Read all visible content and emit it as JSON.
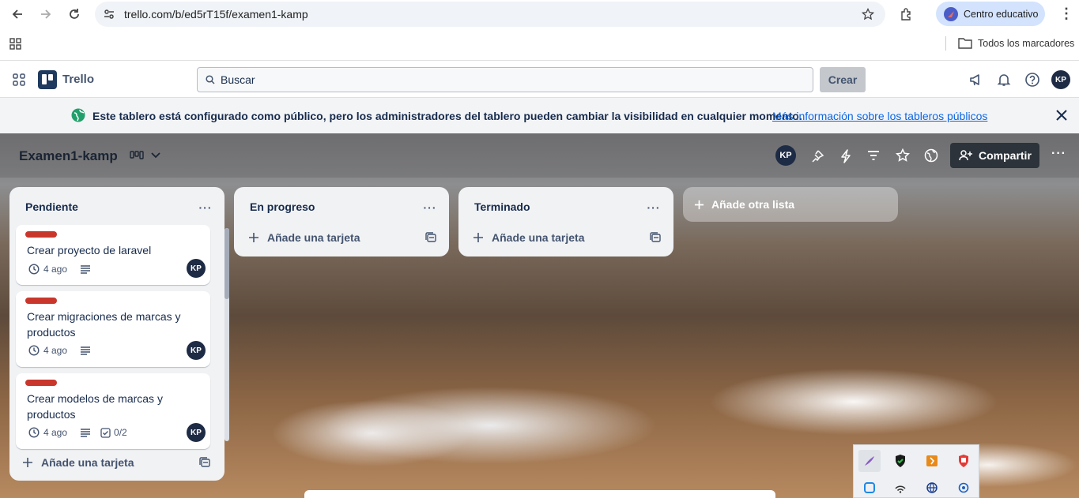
{
  "browser": {
    "url": "trello.com/b/ed5rT15f/examen1-kamp",
    "profile_label": "Centro educativo",
    "bookmarks_label": "Todos los marcadores"
  },
  "header": {
    "app_name": "Trello",
    "search_placeholder": "Buscar",
    "create_label": "Crear",
    "user_initials": "KP"
  },
  "banner": {
    "text": "Este tablero está configurado como público, pero los administradores del tablero pueden cambiar la visibilidad en cualquier momento.",
    "link": "Más información sobre los tableros públicos"
  },
  "board": {
    "title": "Examen1-kamp",
    "member_initials": "KP",
    "share_label": "Compartir",
    "add_list_label": "Añade otra lista"
  },
  "lists": [
    {
      "title": "Pendiente",
      "add_card_label": "Añade una tarjeta",
      "cards": [
        {
          "title": "Crear proyecto de laravel",
          "date": "4 ago",
          "member": "KP",
          "label_color": "#c9372c"
        },
        {
          "title": "Crear migraciones de marcas y productos",
          "date": "4 ago",
          "member": "KP",
          "label_color": "#c9372c"
        },
        {
          "title": "Crear modelos de marcas y productos",
          "date": "4 ago",
          "checklist": "0/2",
          "member": "KP",
          "label_color": "#c9372c"
        }
      ]
    },
    {
      "title": "En progreso",
      "add_card_label": "Añade una tarjeta",
      "cards": []
    },
    {
      "title": "Terminado",
      "add_card_label": "Añade una tarjeta",
      "cards": []
    }
  ],
  "colors": {
    "label_red": "#c9372c",
    "link_blue": "#0c66e4",
    "avatar_navy": "#1e2b45",
    "banner_globe": "#22a06b"
  }
}
